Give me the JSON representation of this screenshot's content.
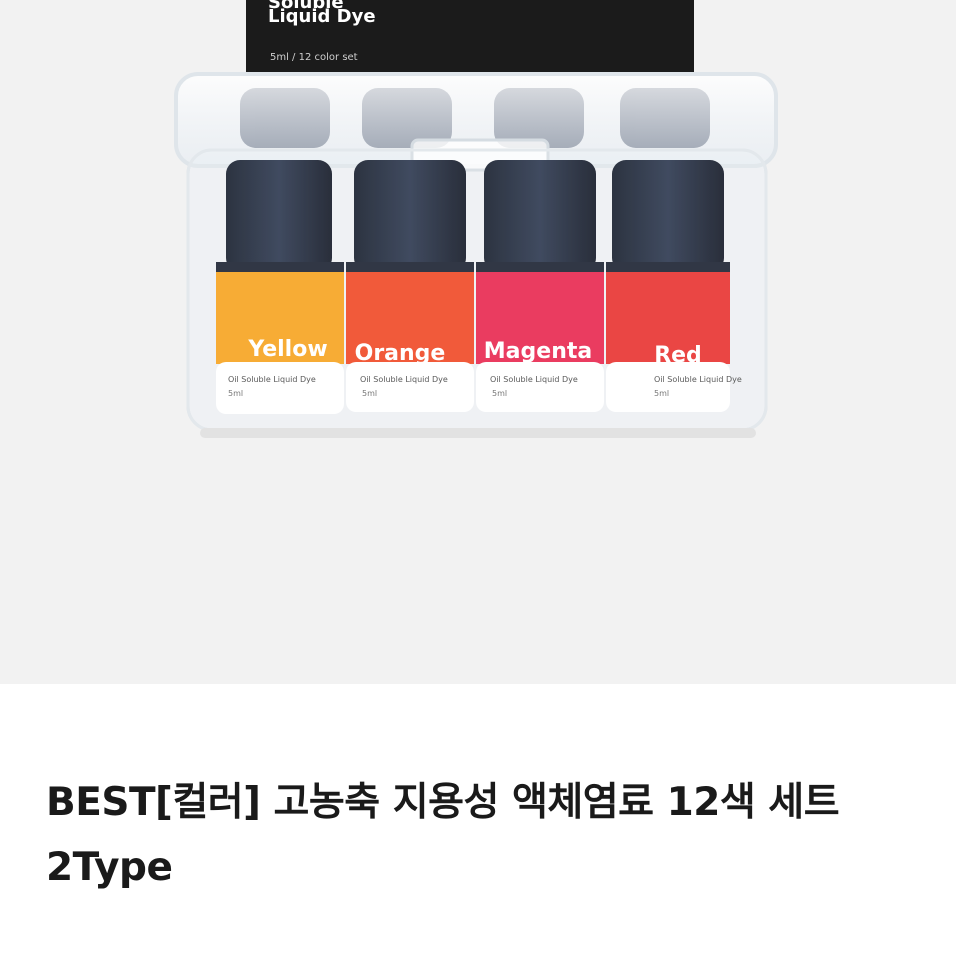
{
  "product": {
    "title": "BEST[컬러] 고농축 지용성 액체염료 12색 세트 2Type",
    "image": {
      "box_label_line1": "Soluble",
      "box_label_line2": "Liquid Dye",
      "box_label_sub": "5ml / 12 color set",
      "bottles": [
        {
          "name": "Yellow",
          "desc": "Oil Soluble Liquid Dye",
          "volume": "5ml",
          "color": "#f6a11a"
        },
        {
          "name": "Orange",
          "desc": "Oil Soluble Liquid Dye",
          "volume": "5ml",
          "color": "#f0441f"
        },
        {
          "name": "Magenta",
          "desc": "Oil Soluble Liquid Dye",
          "volume": "5ml",
          "color": "#e8224a"
        },
        {
          "name": "Red",
          "desc": "Oil Soluble Liquid Dye",
          "volume": "5ml",
          "color": "#e72d2b"
        }
      ]
    }
  }
}
